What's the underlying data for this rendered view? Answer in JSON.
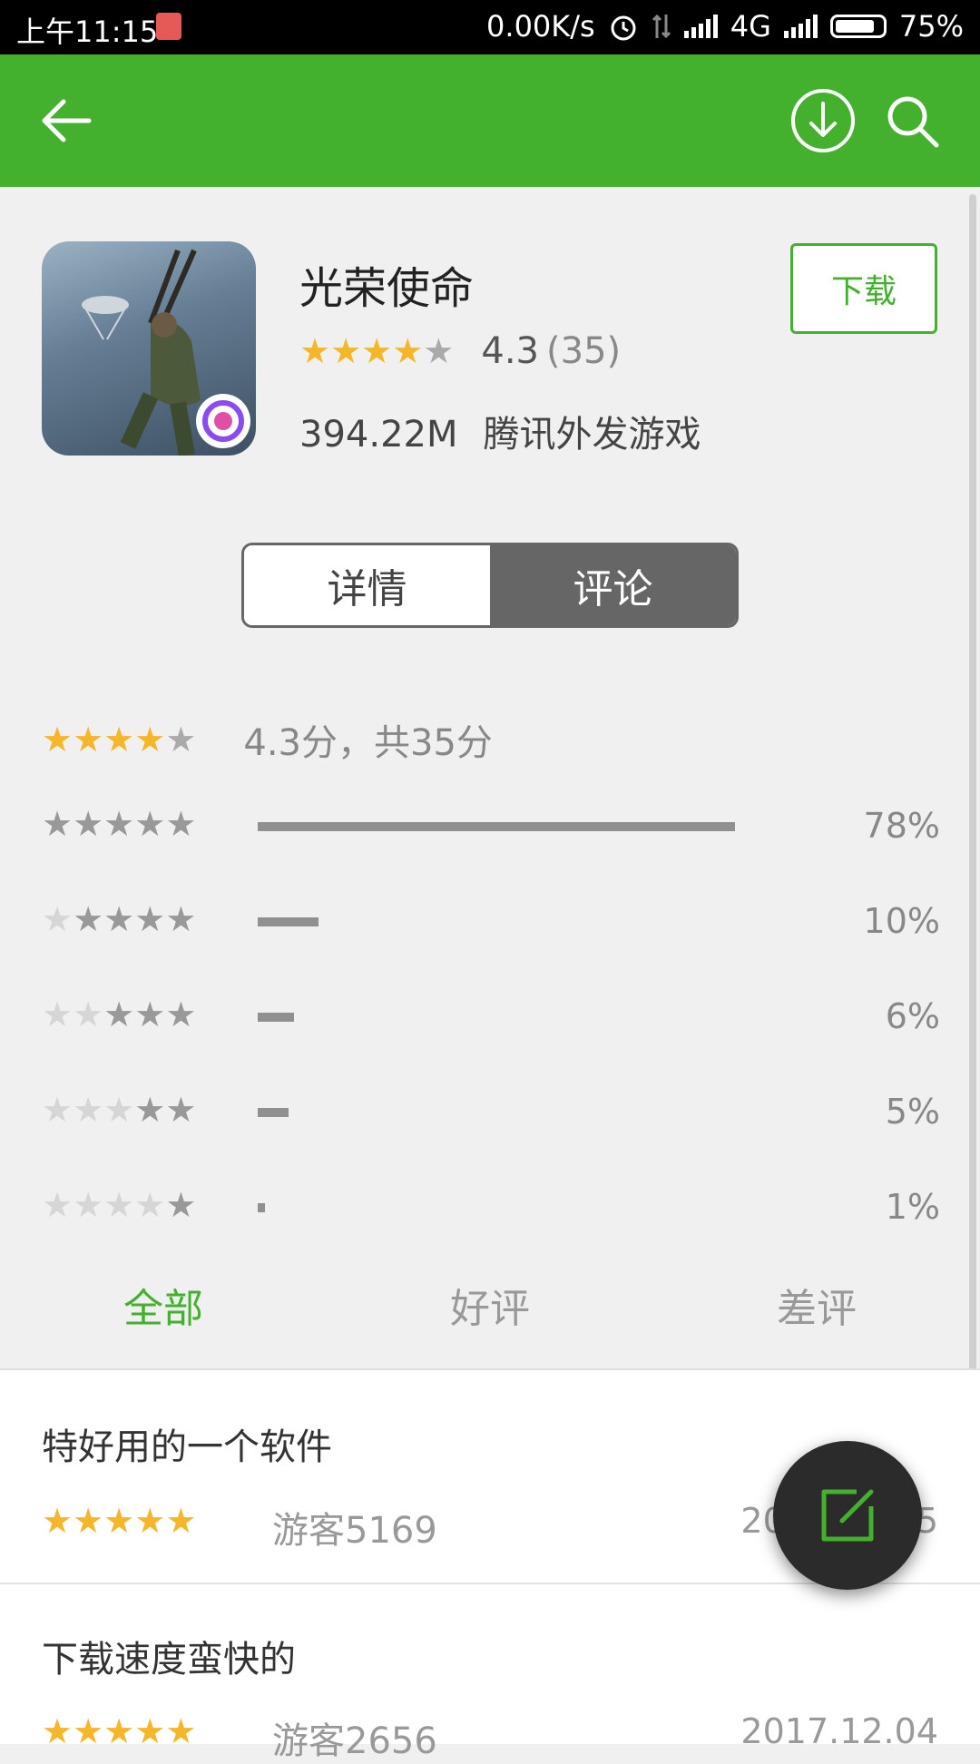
{
  "status_bar": {
    "time": "上午11:15",
    "net_speed": "0.00K/s",
    "network": "4G",
    "battery": "75%"
  },
  "toolbar": {
    "back_icon": "arrow-left-icon",
    "download_icon": "download-circle-icon",
    "search_icon": "search-icon"
  },
  "app": {
    "name": "光荣使命",
    "stars": 4.3,
    "score": "4.3",
    "count": "(35)",
    "size": "394.22M",
    "publisher": "腾讯外发游戏",
    "download_label": "下载"
  },
  "tabs": {
    "detail": "详情",
    "comments": "评论",
    "active": "comments"
  },
  "rating_summary": {
    "text": "4.3分，共35分"
  },
  "distribution": [
    {
      "stars": 5,
      "percent": 78,
      "label": "78%"
    },
    {
      "stars": 4,
      "percent": 10,
      "label": "10%"
    },
    {
      "stars": 3,
      "percent": 6,
      "label": "6%"
    },
    {
      "stars": 2,
      "percent": 5,
      "label": "5%"
    },
    {
      "stars": 1,
      "percent": 1,
      "label": "1%"
    }
  ],
  "filters": {
    "all": "全部",
    "good": "好评",
    "bad": "差评",
    "active": "all"
  },
  "reviews": [
    {
      "title": "特好用的一个软件",
      "stars": 5,
      "user": "游客5169",
      "date": "2017.12.05"
    },
    {
      "title": "下载速度蛮快的",
      "stars": 5,
      "user": "游客2656",
      "date": "2017.12.04"
    }
  ],
  "fab": {
    "icon": "edit-icon"
  },
  "colors": {
    "accent": "#43b02e",
    "star": "#f5b62a",
    "tab_active": "#666666"
  }
}
